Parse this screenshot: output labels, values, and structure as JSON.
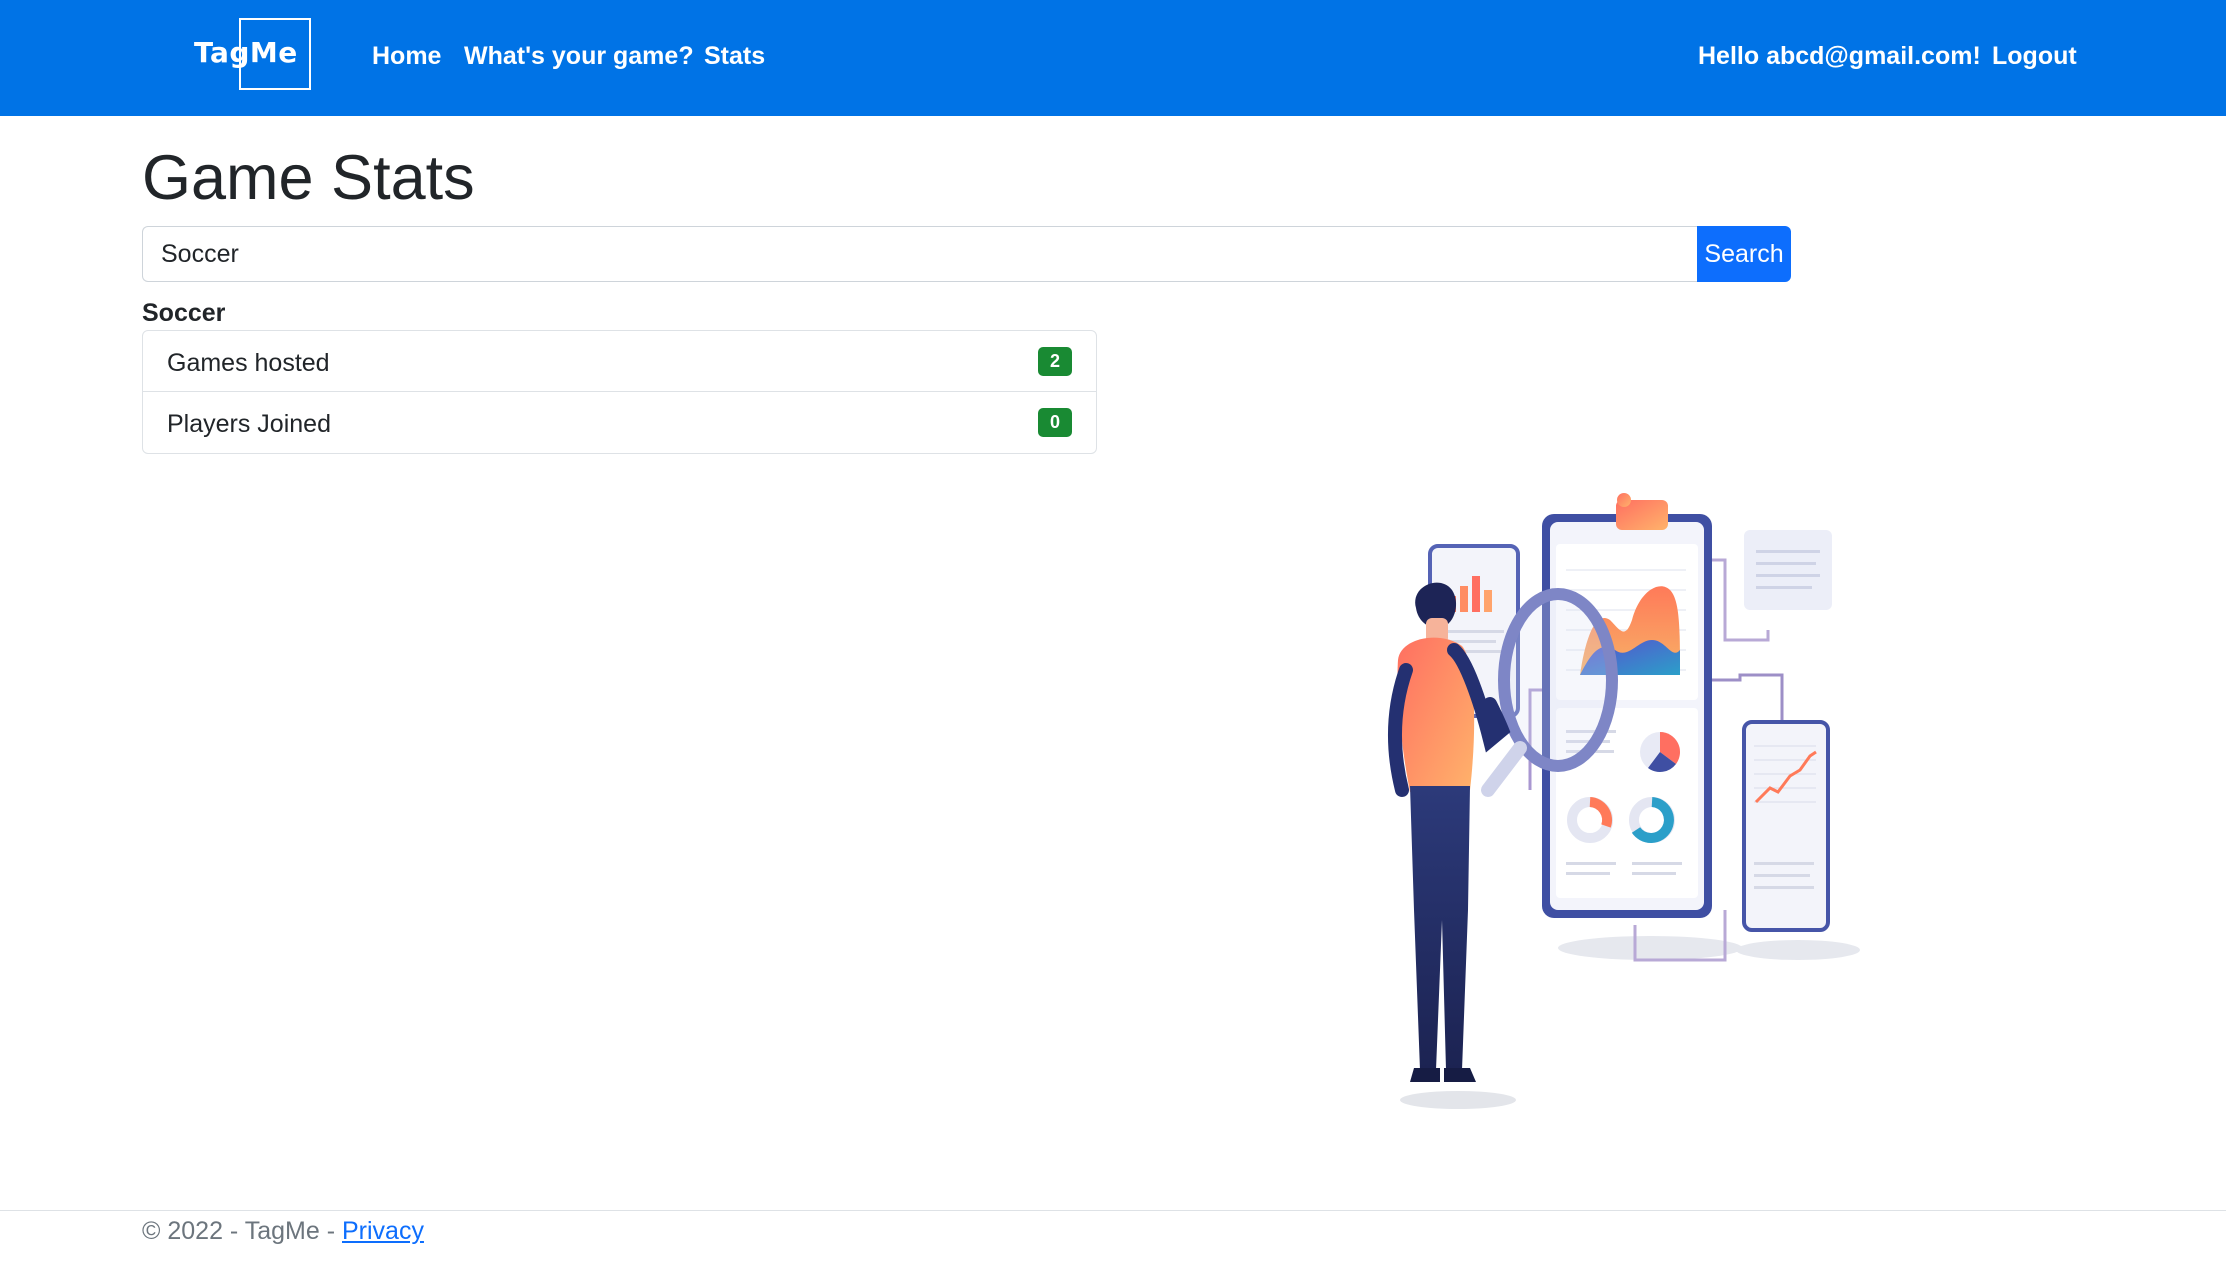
{
  "nav": {
    "brand": "TagMe",
    "links": [
      "Home",
      "What's your game?",
      "Stats"
    ],
    "greeting": "Hello abcd@gmail.com!",
    "logout": "Logout"
  },
  "main": {
    "title": "Game Stats",
    "search_value": "Soccer",
    "search_button": "Search",
    "sport_heading": "Soccer",
    "stats": [
      {
        "label": "Games hosted",
        "value": "2"
      },
      {
        "label": "Players Joined",
        "value": "0"
      }
    ]
  },
  "footer": {
    "copyright": "© 2022 - TagMe - ",
    "privacy": "Privacy"
  },
  "colors": {
    "navbar": "#0073e6",
    "button": "#0d6efd",
    "badge": "#198a33"
  }
}
